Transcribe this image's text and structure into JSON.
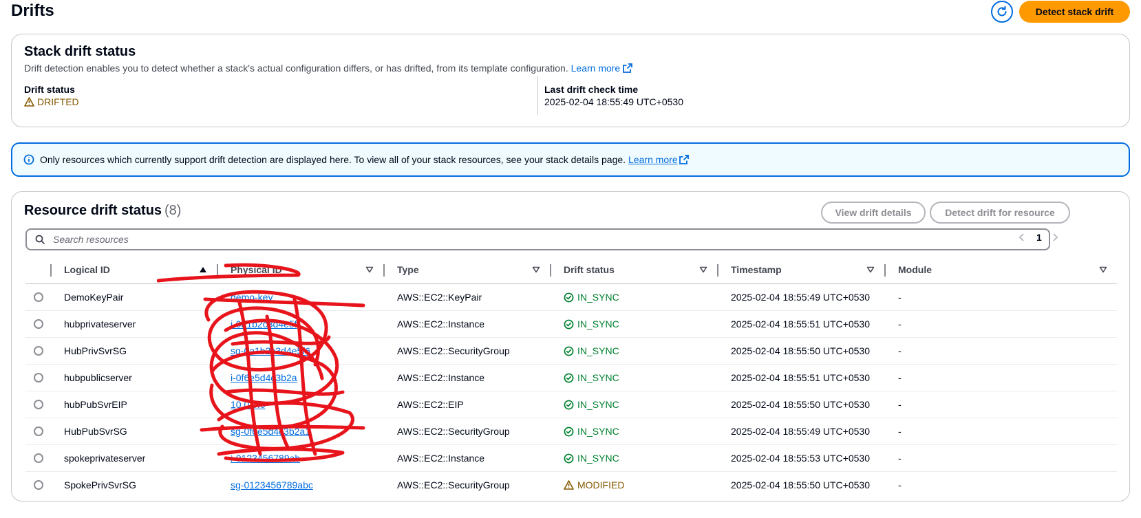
{
  "page_title": "Drifts",
  "header": {
    "refresh_icon": "refresh-icon",
    "detect_stack_drift_label": "Detect stack drift"
  },
  "stack_drift": {
    "title": "Stack drift status",
    "description": "Drift detection enables you to detect whether a stack's actual configuration differs, or has drifted, from its template configuration.",
    "learn_more": "Learn more",
    "drift_status_label": "Drift status",
    "drift_status_value": "DRIFTED",
    "last_check_label": "Last drift check time",
    "last_check_value": "2025-02-04 18:55:49 UTC+0530"
  },
  "info_banner": {
    "text": "Only resources which currently support drift detection are displayed here. To view all of your stack resources, see your stack details page.",
    "learn_more": "Learn more"
  },
  "resources": {
    "title": "Resource drift status",
    "count": "(8)",
    "view_drift_details_label": "View drift details",
    "detect_drift_resource_label": "Detect drift for resource",
    "search_placeholder": "Search resources",
    "page_number": "1",
    "columns": [
      "Logical ID",
      "Physical ID",
      "Type",
      "Drift status",
      "Timestamp",
      "Module"
    ],
    "rows": [
      {
        "logical_id": "DemoKeyPair",
        "physical_id": "demo-key",
        "type": "AWS::EC2::KeyPair",
        "drift": "IN_SYNC",
        "timestamp": "2025-02-04 18:55:49 UTC+0530",
        "module": "-"
      },
      {
        "logical_id": "hubprivateserver",
        "physical_id": "i-0a1b2c3d4e5f",
        "type": "AWS::EC2::Instance",
        "drift": "IN_SYNC",
        "timestamp": "2025-02-04 18:55:51 UTC+0530",
        "module": "-"
      },
      {
        "logical_id": "HubPrivSvrSG",
        "physical_id": "sg-0a1b2c3d4e5f6",
        "type": "AWS::EC2::SecurityGroup",
        "drift": "IN_SYNC",
        "timestamp": "2025-02-04 18:55:50 UTC+0530",
        "module": "-"
      },
      {
        "logical_id": "hubpublicserver",
        "physical_id": "i-0f6e5d4c3b2a",
        "type": "AWS::EC2::Instance",
        "drift": "IN_SYNC",
        "timestamp": "2025-02-04 18:55:51 UTC+0530",
        "module": "-"
      },
      {
        "logical_id": "hubPubSvrEIP",
        "physical_id": "10.0.0.0",
        "type": "AWS::EC2::EIP",
        "drift": "IN_SYNC",
        "timestamp": "2025-02-04 18:55:50 UTC+0530",
        "module": "-"
      },
      {
        "logical_id": "HubPubSvrSG",
        "physical_id": "sg-0f6e5d4c3b2a1",
        "type": "AWS::EC2::SecurityGroup",
        "drift": "IN_SYNC",
        "timestamp": "2025-02-04 18:55:49 UTC+0530",
        "module": "-"
      },
      {
        "logical_id": "spokeprivateserver",
        "physical_id": "i-0123456789ab",
        "type": "AWS::EC2::Instance",
        "drift": "IN_SYNC",
        "timestamp": "2025-02-04 18:55:53 UTC+0530",
        "module": "-"
      },
      {
        "logical_id": "SpokePrivSvrSG",
        "physical_id": "sg-0123456789abc",
        "type": "AWS::EC2::SecurityGroup",
        "drift": "MODIFIED",
        "timestamp": "2025-02-04 18:55:50 UTC+0530",
        "module": "-"
      }
    ]
  },
  "colors": {
    "primary": "#ff9900",
    "link": "#006ce0",
    "in_sync": "#00802f",
    "modified": "#855900",
    "redaction": "#e8141c"
  }
}
